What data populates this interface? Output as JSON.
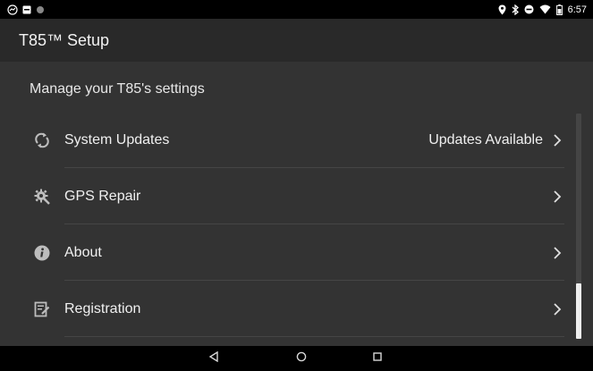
{
  "status_bar": {
    "time": "6:57",
    "left_icons": [
      "app-notification-icon",
      "image-notification-icon",
      "dot-notification-icon"
    ],
    "right_icons": [
      "location-icon",
      "bluetooth-icon",
      "do-not-disturb-icon",
      "wifi-icon",
      "battery-icon"
    ]
  },
  "toolbar": {
    "title": "T85™ Setup"
  },
  "main": {
    "section_header": "Manage your T85's settings",
    "items": [
      {
        "label": "System Updates",
        "value": "Updates Available",
        "icon": "sync-icon"
      },
      {
        "label": "GPS Repair",
        "value": "",
        "icon": "gear-wrench-icon"
      },
      {
        "label": "About",
        "value": "",
        "icon": "info-icon"
      },
      {
        "label": "Registration",
        "value": "",
        "icon": "edit-document-icon"
      }
    ]
  },
  "nav_bar": {
    "buttons": [
      "back-icon",
      "home-icon",
      "recents-icon"
    ]
  },
  "colors": {
    "background": "#333333",
    "toolbar": "#292929",
    "status_bar": "#000000",
    "text": "#f0f0f0"
  }
}
